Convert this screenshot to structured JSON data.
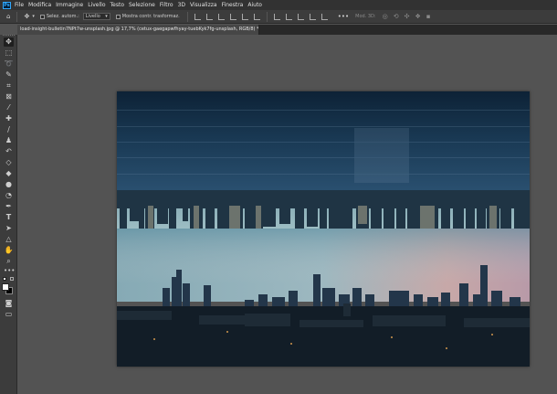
{
  "app": {
    "logo_text": "Ps"
  },
  "menu": [
    "File",
    "Modifica",
    "Immagine",
    "Livello",
    "Testo",
    "Selezione",
    "Filtro",
    "3D",
    "Visualizza",
    "Finestra",
    "Aiuto"
  ],
  "options": {
    "auto_select_label": "Selez. autom.:",
    "layer_select_value": "Livello",
    "show_transform_label": "Mostra contr. trasformaz.",
    "mode_3d_label": "Mod. 3D:",
    "more": "•••"
  },
  "tab": {
    "title": "load-insight-bulletin7NPt7w-unsplash.jpg @ 17,7% (cetux-gaegapwfhyay-tuebKyk7fg-unsplash, RGB/8) *",
    "close": "×"
  },
  "toolbar": {
    "more": "•••"
  },
  "colors": {
    "foreground": "#ffffff",
    "background": "#000000",
    "accent": "#31a8ff"
  }
}
